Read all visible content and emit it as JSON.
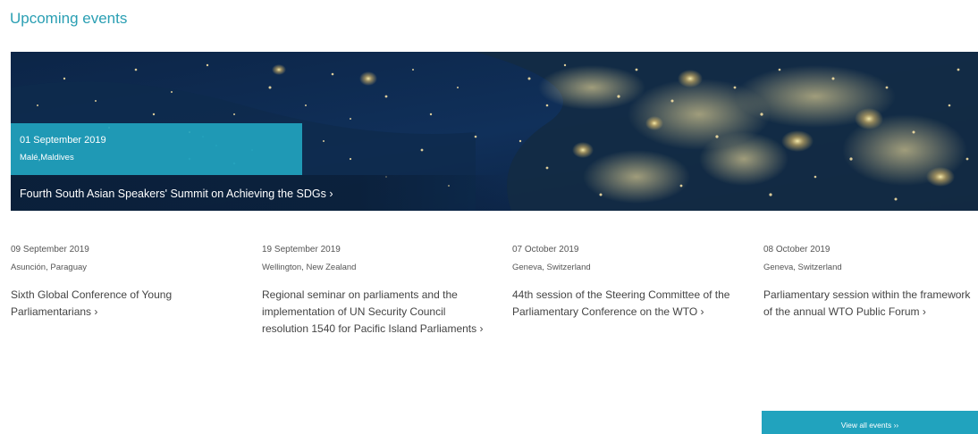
{
  "section": {
    "title": "Upcoming events"
  },
  "featured": {
    "date": "01 September 2019",
    "location": "Malé,Maldives",
    "title": "Fourth South Asian Speakers' Summit on Achieving the SDGs ›"
  },
  "events": [
    {
      "date": "09 September 2019",
      "location": "Asunción, Paraguay",
      "title": "Sixth Global Conference of Young Parliamentarians ›"
    },
    {
      "date": "19 September 2019",
      "location": "Wellington, New Zealand",
      "title": "Regional seminar on parliaments and the implementation of UN Security Council resolution 1540 for Pacific Island Parliaments ›"
    },
    {
      "date": "07 October 2019",
      "location": "Geneva, Switzerland",
      "title": "44th session of the Steering Committee of the Parliamentary Conference on the WTO ›"
    },
    {
      "date": "08 October 2019",
      "location": "Geneva, Switzerland",
      "title": "Parliamentary session within the framework of the annual WTO Public Forum ›"
    }
  ],
  "view_all": {
    "label": "View all events ››"
  },
  "colors": {
    "accent": "#21a3be",
    "title": "#2a9fb3",
    "text": "#444444"
  }
}
